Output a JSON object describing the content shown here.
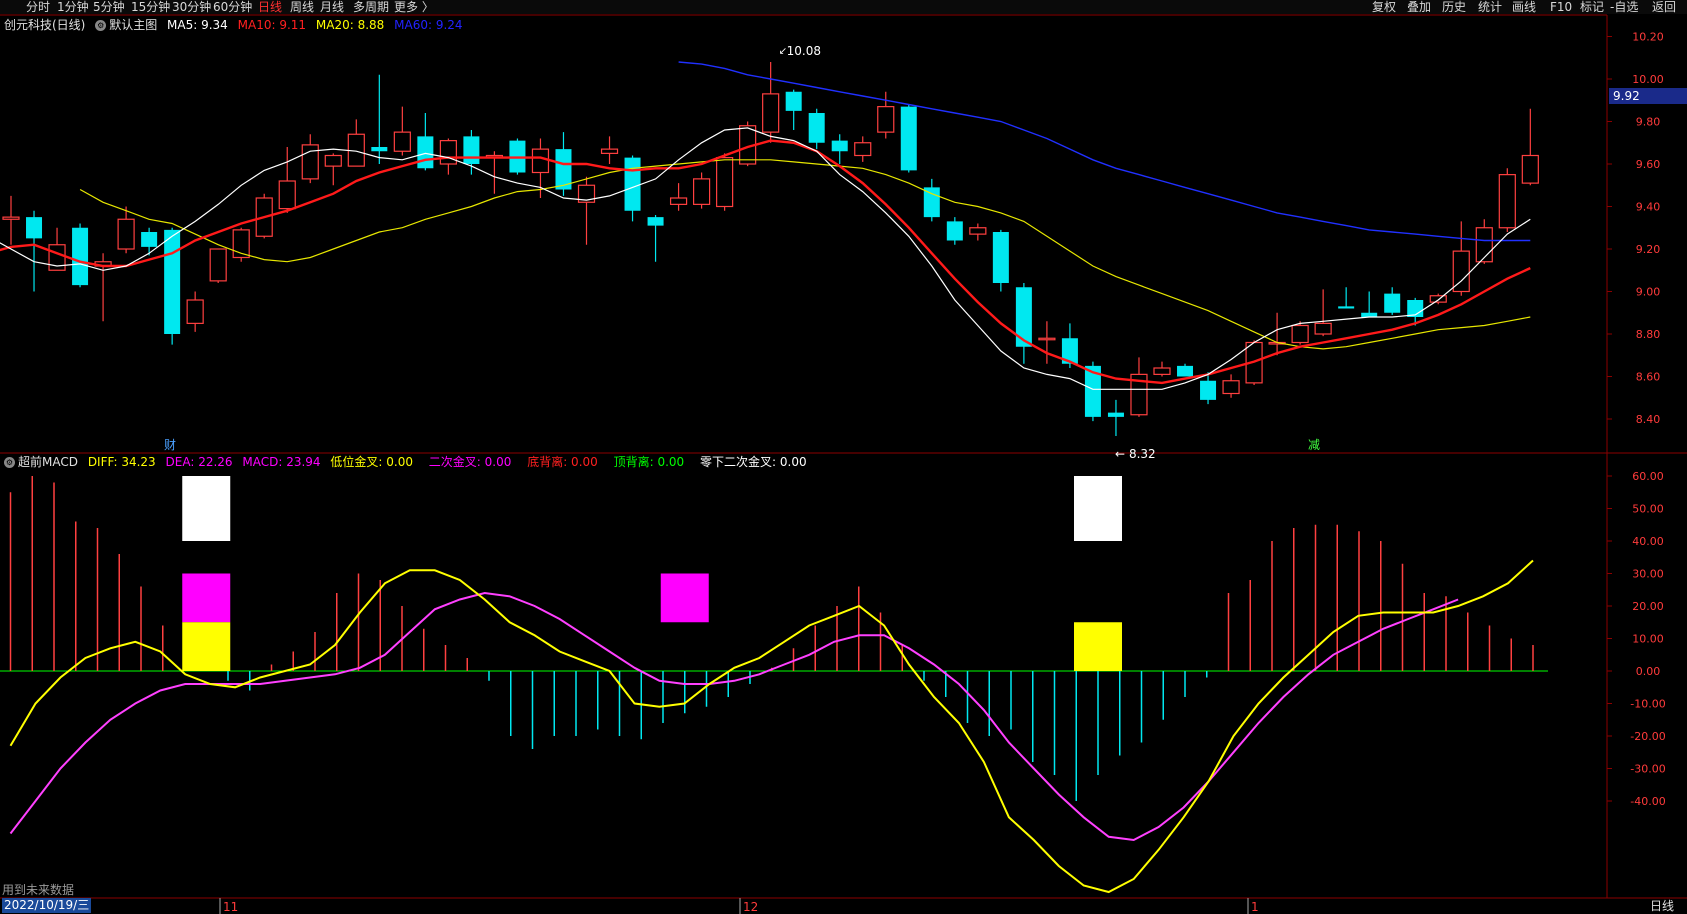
{
  "toolbar": {
    "periods": [
      "分时",
      "1分钟",
      "5分钟",
      "15分钟",
      "30分钟",
      "60分钟",
      "日线",
      "周线",
      "月线",
      "多周期",
      "更多 〉"
    ],
    "active_period": "日线",
    "tools": [
      "复权",
      "叠加",
      "历史",
      "统计",
      "画线",
      "F10",
      "标记",
      "-自选",
      "返回"
    ]
  },
  "main_header": {
    "stock": "创元科技(日线)",
    "template": "默认主图",
    "ma": [
      {
        "label": "MA5: 9.34",
        "color": "#ffffff"
      },
      {
        "label": "MA10: 9.11",
        "color": "#ff2020"
      },
      {
        "label": "MA20: 8.88",
        "color": "#ffff00"
      },
      {
        "label": "MA60: 9.24",
        "color": "#2222ff"
      }
    ]
  },
  "macd_header": {
    "name": "超前MACD",
    "items": [
      {
        "label": "DIFF: 34.23",
        "color": "#ffff00"
      },
      {
        "label": "DEA: 22.26",
        "color": "#ff00ff"
      },
      {
        "label": "MACD: 23.94",
        "color": "#ff00ff"
      },
      {
        "label": "低位金叉: 0.00",
        "color": "#ffff00"
      },
      {
        "label": "二次金叉: 0.00",
        "color": "#ff00ff"
      },
      {
        "label": "底背离: 0.00",
        "color": "#ff2020"
      },
      {
        "label": "顶背离: 0.00",
        "color": "#00ff00"
      },
      {
        "label": "零下二次金叉: 0.00",
        "color": "#ffffff"
      }
    ]
  },
  "footer": {
    "future_note": "用到未来数据",
    "date": "2022/10/19/三",
    "period": "日线",
    "month_labels": [
      "11",
      "12",
      "1"
    ]
  },
  "markers": {
    "cai": "财",
    "jian": "减"
  },
  "colors": {
    "up": "#ff4040",
    "down": "#00e8f0",
    "ma5": "#ffffff",
    "ma10": "#ff1a1a",
    "ma20": "#e6e600",
    "ma60": "#2030ff",
    "diff": "#ffff00",
    "dea": "#ff40ff",
    "zero": "#00ff00",
    "grid": "#8b0000"
  },
  "chart_data": [
    {
      "type": "candlestick",
      "y_axis_ticks": [
        "10.20",
        "10.00",
        "9.80",
        "9.60",
        "9.40",
        "9.20",
        "9.00",
        "8.80",
        "8.60",
        "8.40"
      ],
      "ylim": [
        8.28,
        10.26
      ],
      "current_price": "9.92",
      "high_label": "10.08",
      "low_label": "8.32",
      "candles": [
        {
          "o": 9.34,
          "h": 9.45,
          "l": 9.22,
          "c": 9.35
        },
        {
          "o": 9.35,
          "h": 9.38,
          "l": 9.0,
          "c": 9.25
        },
        {
          "o": 9.1,
          "h": 9.3,
          "l": 9.1,
          "c": 9.22
        },
        {
          "o": 9.3,
          "h": 9.32,
          "l": 9.02,
          "c": 9.03
        },
        {
          "o": 9.12,
          "h": 9.18,
          "l": 8.86,
          "c": 9.14
        },
        {
          "o": 9.2,
          "h": 9.4,
          "l": 9.18,
          "c": 9.34
        },
        {
          "o": 9.28,
          "h": 9.3,
          "l": 9.17,
          "c": 9.21
        },
        {
          "o": 9.29,
          "h": 9.3,
          "l": 8.75,
          "c": 8.8
        },
        {
          "o": 8.85,
          "h": 9.0,
          "l": 8.81,
          "c": 8.96
        },
        {
          "o": 9.05,
          "h": 9.2,
          "l": 9.04,
          "c": 9.2
        },
        {
          "o": 9.16,
          "h": 9.3,
          "l": 9.14,
          "c": 9.29
        },
        {
          "o": 9.26,
          "h": 9.46,
          "l": 9.25,
          "c": 9.44
        },
        {
          "o": 9.39,
          "h": 9.68,
          "l": 9.37,
          "c": 9.52
        },
        {
          "o": 9.53,
          "h": 9.74,
          "l": 9.51,
          "c": 9.69
        },
        {
          "o": 9.59,
          "h": 9.65,
          "l": 9.5,
          "c": 9.64
        },
        {
          "o": 9.59,
          "h": 9.81,
          "l": 9.59,
          "c": 9.74
        },
        {
          "o": 9.68,
          "h": 10.02,
          "l": 9.6,
          "c": 9.66
        },
        {
          "o": 9.66,
          "h": 9.87,
          "l": 9.64,
          "c": 9.75
        },
        {
          "o": 9.73,
          "h": 9.84,
          "l": 9.57,
          "c": 9.58
        },
        {
          "o": 9.6,
          "h": 9.72,
          "l": 9.55,
          "c": 9.71
        },
        {
          "o": 9.73,
          "h": 9.76,
          "l": 9.55,
          "c": 9.6
        },
        {
          "o": 9.64,
          "h": 9.66,
          "l": 9.46,
          "c": 9.64
        },
        {
          "o": 9.71,
          "h": 9.72,
          "l": 9.55,
          "c": 9.56
        },
        {
          "o": 9.56,
          "h": 9.72,
          "l": 9.44,
          "c": 9.67
        },
        {
          "o": 9.67,
          "h": 9.75,
          "l": 9.45,
          "c": 9.48
        },
        {
          "o": 9.42,
          "h": 9.54,
          "l": 9.22,
          "c": 9.5
        },
        {
          "o": 9.65,
          "h": 9.73,
          "l": 9.6,
          "c": 9.67
        },
        {
          "o": 9.63,
          "h": 9.64,
          "l": 9.33,
          "c": 9.38
        },
        {
          "o": 9.35,
          "h": 9.36,
          "l": 9.14,
          "c": 9.31
        },
        {
          "o": 9.41,
          "h": 9.51,
          "l": 9.38,
          "c": 9.44
        },
        {
          "o": 9.41,
          "h": 9.56,
          "l": 9.39,
          "c": 9.53
        },
        {
          "o": 9.4,
          "h": 9.65,
          "l": 9.38,
          "c": 9.63
        },
        {
          "o": 9.6,
          "h": 9.8,
          "l": 9.59,
          "c": 9.78
        },
        {
          "o": 9.75,
          "h": 10.08,
          "l": 9.7,
          "c": 9.93
        },
        {
          "o": 9.94,
          "h": 9.95,
          "l": 9.76,
          "c": 9.85
        },
        {
          "o": 9.84,
          "h": 9.86,
          "l": 9.67,
          "c": 9.7
        },
        {
          "o": 9.71,
          "h": 9.74,
          "l": 9.6,
          "c": 9.66
        },
        {
          "o": 9.64,
          "h": 9.73,
          "l": 9.61,
          "c": 9.7
        },
        {
          "o": 9.75,
          "h": 9.94,
          "l": 9.72,
          "c": 9.87
        },
        {
          "o": 9.87,
          "h": 9.88,
          "l": 9.56,
          "c": 9.57
        },
        {
          "o": 9.49,
          "h": 9.53,
          "l": 9.33,
          "c": 9.35
        },
        {
          "o": 9.33,
          "h": 9.35,
          "l": 9.22,
          "c": 9.24
        },
        {
          "o": 9.27,
          "h": 9.32,
          "l": 9.24,
          "c": 9.3
        },
        {
          "o": 9.28,
          "h": 9.29,
          "l": 9.0,
          "c": 9.04
        },
        {
          "o": 9.02,
          "h": 9.04,
          "l": 8.66,
          "c": 8.74
        },
        {
          "o": 8.78,
          "h": 8.86,
          "l": 8.66,
          "c": 8.78
        },
        {
          "o": 8.78,
          "h": 8.85,
          "l": 8.64,
          "c": 8.66
        },
        {
          "o": 8.65,
          "h": 8.67,
          "l": 8.39,
          "c": 8.41
        },
        {
          "o": 8.43,
          "h": 8.49,
          "l": 8.32,
          "c": 8.41
        },
        {
          "o": 8.42,
          "h": 8.69,
          "l": 8.41,
          "c": 8.61
        },
        {
          "o": 8.61,
          "h": 8.67,
          "l": 8.6,
          "c": 8.64
        },
        {
          "o": 8.65,
          "h": 8.66,
          "l": 8.6,
          "c": 8.6
        },
        {
          "o": 8.58,
          "h": 8.62,
          "l": 8.47,
          "c": 8.49
        },
        {
          "o": 8.52,
          "h": 8.61,
          "l": 8.5,
          "c": 8.58
        },
        {
          "o": 8.57,
          "h": 8.77,
          "l": 8.56,
          "c": 8.76
        },
        {
          "o": 8.76,
          "h": 8.9,
          "l": 8.7,
          "c": 8.76
        },
        {
          "o": 8.76,
          "h": 8.86,
          "l": 8.75,
          "c": 8.84
        },
        {
          "o": 8.8,
          "h": 9.01,
          "l": 8.79,
          "c": 8.85
        },
        {
          "o": 8.93,
          "h": 9.02,
          "l": 8.92,
          "c": 8.92
        },
        {
          "o": 8.9,
          "h": 9.0,
          "l": 8.88,
          "c": 8.88
        },
        {
          "o": 8.99,
          "h": 9.02,
          "l": 8.89,
          "c": 8.9
        },
        {
          "o": 8.96,
          "h": 8.97,
          "l": 8.84,
          "c": 8.88
        },
        {
          "o": 8.95,
          "h": 8.99,
          "l": 8.94,
          "c": 8.98
        },
        {
          "o": 9.0,
          "h": 9.33,
          "l": 8.98,
          "c": 9.19
        },
        {
          "o": 9.14,
          "h": 9.34,
          "l": 9.13,
          "c": 9.3
        },
        {
          "o": 9.3,
          "h": 9.58,
          "l": 9.28,
          "c": 9.55
        },
        {
          "o": 9.51,
          "h": 9.86,
          "l": 9.5,
          "c": 9.64
        }
      ],
      "ma5": [
        9.28,
        9.3,
        9.29,
        9.26,
        9.2,
        9.14,
        9.12,
        9.13,
        9.1,
        9.12,
        9.18,
        9.26,
        9.33,
        9.41,
        9.5,
        9.57,
        9.61,
        9.66,
        9.67,
        9.66,
        9.63,
        9.62,
        9.65,
        9.63,
        9.59,
        9.54,
        9.51,
        9.49,
        9.44,
        9.43,
        9.45,
        9.49,
        9.53,
        9.62,
        9.7,
        9.76,
        9.77,
        9.73,
        9.71,
        9.66,
        9.55,
        9.47,
        9.37,
        9.26,
        9.12,
        8.96,
        8.84,
        8.72,
        8.64,
        8.61,
        8.59,
        8.54,
        8.54,
        8.54,
        8.54,
        8.57,
        8.61,
        8.68,
        8.76,
        8.82,
        8.85,
        8.86,
        8.87,
        8.88,
        8.88,
        8.89,
        8.96,
        9.05,
        9.16,
        9.27,
        9.34
      ],
      "ma10": [
        9.12,
        9.13,
        9.14,
        9.18,
        9.21,
        9.22,
        9.18,
        9.14,
        9.12,
        9.12,
        9.15,
        9.18,
        9.24,
        9.28,
        9.32,
        9.35,
        9.38,
        9.42,
        9.46,
        9.52,
        9.56,
        9.59,
        9.62,
        9.63,
        9.63,
        9.63,
        9.63,
        9.63,
        9.6,
        9.6,
        9.58,
        9.57,
        9.58,
        9.58,
        9.6,
        9.64,
        9.68,
        9.71,
        9.7,
        9.66,
        9.59,
        9.51,
        9.41,
        9.3,
        9.18,
        9.06,
        8.95,
        8.85,
        8.77,
        8.71,
        8.67,
        8.62,
        8.59,
        8.58,
        8.57,
        8.59,
        8.61,
        8.64,
        8.67,
        8.71,
        8.74,
        8.76,
        8.78,
        8.8,
        8.82,
        8.85,
        8.89,
        8.94,
        9.0,
        9.06,
        9.11
      ],
      "ma20": [
        9.48,
        9.42,
        9.38,
        9.34,
        9.32,
        9.27,
        9.22,
        9.18,
        9.15,
        9.14,
        9.16,
        9.2,
        9.24,
        9.28,
        9.3,
        9.34,
        9.37,
        9.4,
        9.44,
        9.47,
        9.48,
        9.5,
        9.53,
        9.56,
        9.58,
        9.59,
        9.6,
        9.61,
        9.62,
        9.62,
        9.62,
        9.61,
        9.6,
        9.59,
        9.58,
        9.55,
        9.51,
        9.46,
        9.42,
        9.4,
        9.37,
        9.33,
        9.26,
        9.19,
        9.12,
        9.07,
        9.03,
        8.99,
        8.95,
        8.91,
        8.86,
        8.81,
        8.76,
        8.74,
        8.73,
        8.74,
        8.76,
        8.78,
        8.8,
        8.82,
        8.83,
        8.84,
        8.86,
        8.88
      ],
      "ma60": [
        10.08,
        10.07,
        10.05,
        10.02,
        10.0,
        9.98,
        9.96,
        9.94,
        9.92,
        9.9,
        9.88,
        9.86,
        9.84,
        9.82,
        9.8,
        9.76,
        9.72,
        9.67,
        9.62,
        9.58,
        9.55,
        9.52,
        9.49,
        9.46,
        9.43,
        9.4,
        9.37,
        9.35,
        9.33,
        9.31,
        9.29,
        9.28,
        9.27,
        9.26,
        9.25,
        9.24,
        9.24,
        9.24
      ]
    },
    {
      "type": "macd",
      "y_axis_ticks": [
        "60.00",
        "50.00",
        "40.00",
        "30.00",
        "20.00",
        "10.00",
        "0.00",
        "-10.00",
        "-20.00",
        "-30.00",
        "-40.00"
      ],
      "ylim": [
        -70,
        65
      ],
      "diff": [
        -23,
        -10,
        -2,
        4,
        7,
        9,
        6,
        -1,
        -4,
        -5,
        -2,
        0,
        2,
        8,
        18,
        27,
        31,
        31,
        28,
        22,
        15,
        11,
        6,
        3,
        0,
        -10,
        -11,
        -10,
        -4,
        1,
        4,
        9,
        14,
        17,
        20,
        14,
        2,
        -8,
        -16,
        -28,
        -45,
        -52,
        -60,
        -66,
        -68,
        -64,
        -55,
        -45,
        -34,
        -20,
        -10,
        -2,
        5,
        12,
        17,
        18,
        18,
        18,
        20,
        23,
        27,
        34
      ],
      "dea": [
        -50,
        -40,
        -30,
        -22,
        -15,
        -10,
        -6,
        -4,
        -4,
        -4,
        -4,
        -3,
        -2,
        -1,
        1,
        5,
        12,
        19,
        22,
        24,
        23,
        20,
        16,
        11,
        6,
        1,
        -3,
        -4,
        -4,
        -3,
        -1,
        2,
        5,
        9,
        11,
        11,
        7,
        2,
        -4,
        -12,
        -22,
        -30,
        -38,
        -45,
        -51,
        -52,
        -48,
        -42,
        -34,
        -25,
        -16,
        -8,
        -1,
        5,
        9,
        13,
        16,
        19,
        22
      ],
      "macd_bars": [
        55,
        60,
        58,
        46,
        44,
        36,
        26,
        14,
        8,
        4,
        -3,
        -6,
        2,
        6,
        12,
        24,
        30,
        28,
        20,
        13,
        8,
        4,
        -3,
        -20,
        -24,
        -20,
        -20,
        -18,
        -20,
        -21,
        -16,
        -13,
        -11,
        -8,
        -4,
        1,
        7,
        14,
        20,
        26,
        18,
        8,
        -3,
        -8,
        -16,
        -20,
        -18,
        -28,
        -32,
        -40,
        -32,
        -26,
        -22,
        -15,
        -8,
        -2,
        24,
        28,
        40,
        44,
        45,
        45,
        43,
        40,
        33,
        24,
        23,
        18,
        14,
        10,
        8
      ],
      "signal_blocks": [
        {
          "at": 9,
          "signal": "零下二次金叉",
          "lo": 40,
          "hi": 60,
          "color": "#ffffff"
        },
        {
          "at": 9,
          "signal": "二次金叉",
          "lo": 15,
          "hi": 30,
          "color": "#ff00ff"
        },
        {
          "at": 9,
          "signal": "低位金叉",
          "lo": 0,
          "hi": 15,
          "color": "#ffff00"
        },
        {
          "at": 31,
          "signal": "二次金叉",
          "lo": 15,
          "hi": 30,
          "color": "#ff00ff"
        },
        {
          "at": 50,
          "signal": "零下二次金叉",
          "lo": 40,
          "hi": 60,
          "color": "#ffffff"
        },
        {
          "at": 50,
          "signal": "低位金叉",
          "lo": 0,
          "hi": 15,
          "color": "#ffff00"
        }
      ]
    }
  ]
}
